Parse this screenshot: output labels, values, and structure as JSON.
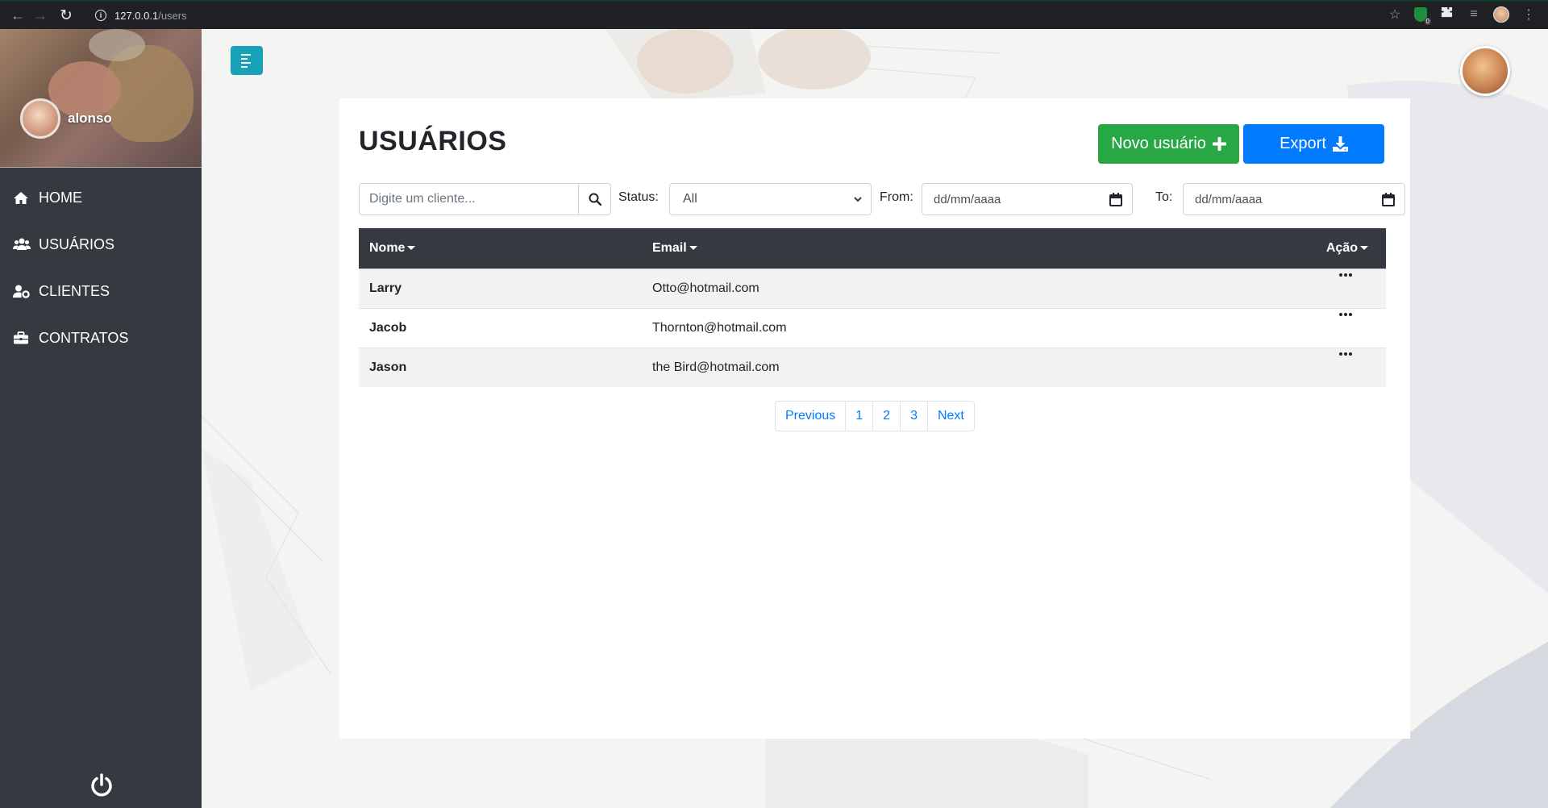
{
  "browser": {
    "url_host": "127.0.0.1",
    "url_path": "/users",
    "extension_badge": "0"
  },
  "sidebar": {
    "username": "alonso",
    "items": [
      {
        "label": "HOME",
        "icon": "home-icon"
      },
      {
        "label": "USUÁRIOS",
        "icon": "users-icon"
      },
      {
        "label": "CLIENTES",
        "icon": "user-cog-icon"
      },
      {
        "label": "CONTRATOS",
        "icon": "briefcase-icon"
      }
    ]
  },
  "page": {
    "title": "USUÁRIOS",
    "new_user_label": "Novo usuário",
    "export_label": "Export"
  },
  "filters": {
    "search_placeholder": "Digite um cliente...",
    "status_label": "Status:",
    "status_value": "All",
    "from_label": "From:",
    "from_value": "dd/mm/aaaa",
    "to_label": "To:",
    "to_value": "dd/mm/aaaa"
  },
  "table": {
    "headers": {
      "name": "Nome",
      "email": "Email",
      "action": "Ação"
    },
    "rows": [
      {
        "name": "Larry",
        "email": "Otto@hotmail.com"
      },
      {
        "name": "Jacob",
        "email": "Thornton@hotmail.com"
      },
      {
        "name": "Jason",
        "email": "the Bird@hotmail.com"
      }
    ]
  },
  "pagination": {
    "previous": "Previous",
    "pages": [
      "1",
      "2",
      "3"
    ],
    "next": "Next"
  },
  "colors": {
    "sidebar_bg": "#343a40",
    "success": "#28a745",
    "primary": "#007bff",
    "info": "#17a2b8"
  }
}
